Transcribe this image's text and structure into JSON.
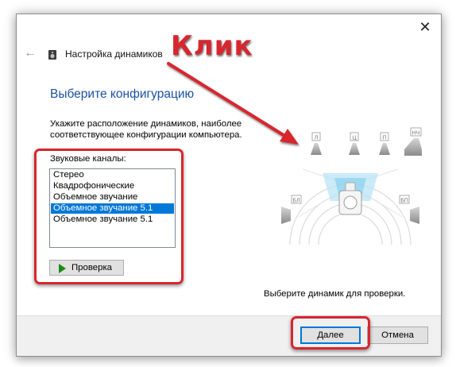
{
  "window": {
    "title": "Настройка динамиков",
    "close_glyph": "✕",
    "back_glyph": "←"
  },
  "page": {
    "heading": "Выберите конфигурацию",
    "instructions": "Укажите расположение динамиков, наиболее соответствующее конфигурации компьютера.",
    "channels_label": "Звуковые каналы:",
    "channels": [
      "Стерео",
      "Квадрофонические",
      "Объемное звучание",
      "Объемное звучание 5.1",
      "Объемное звучание 5.1"
    ],
    "selected_channel_index": 3,
    "test_button": "Проверка",
    "status": "Выберите динамик для проверки."
  },
  "speakers": {
    "front_left": "Л",
    "center": "Ц",
    "front_right": "П",
    "subwoofer": "НЧ",
    "rear_left": "БЛ",
    "rear_right": "БП"
  },
  "footer": {
    "next_button": "Далее",
    "cancel_button": "Отмена"
  },
  "annotation": {
    "click_label": "Клик",
    "color": "#d8262e"
  },
  "colors": {
    "heading": "#1b50a6",
    "selection": "#0078d7"
  }
}
